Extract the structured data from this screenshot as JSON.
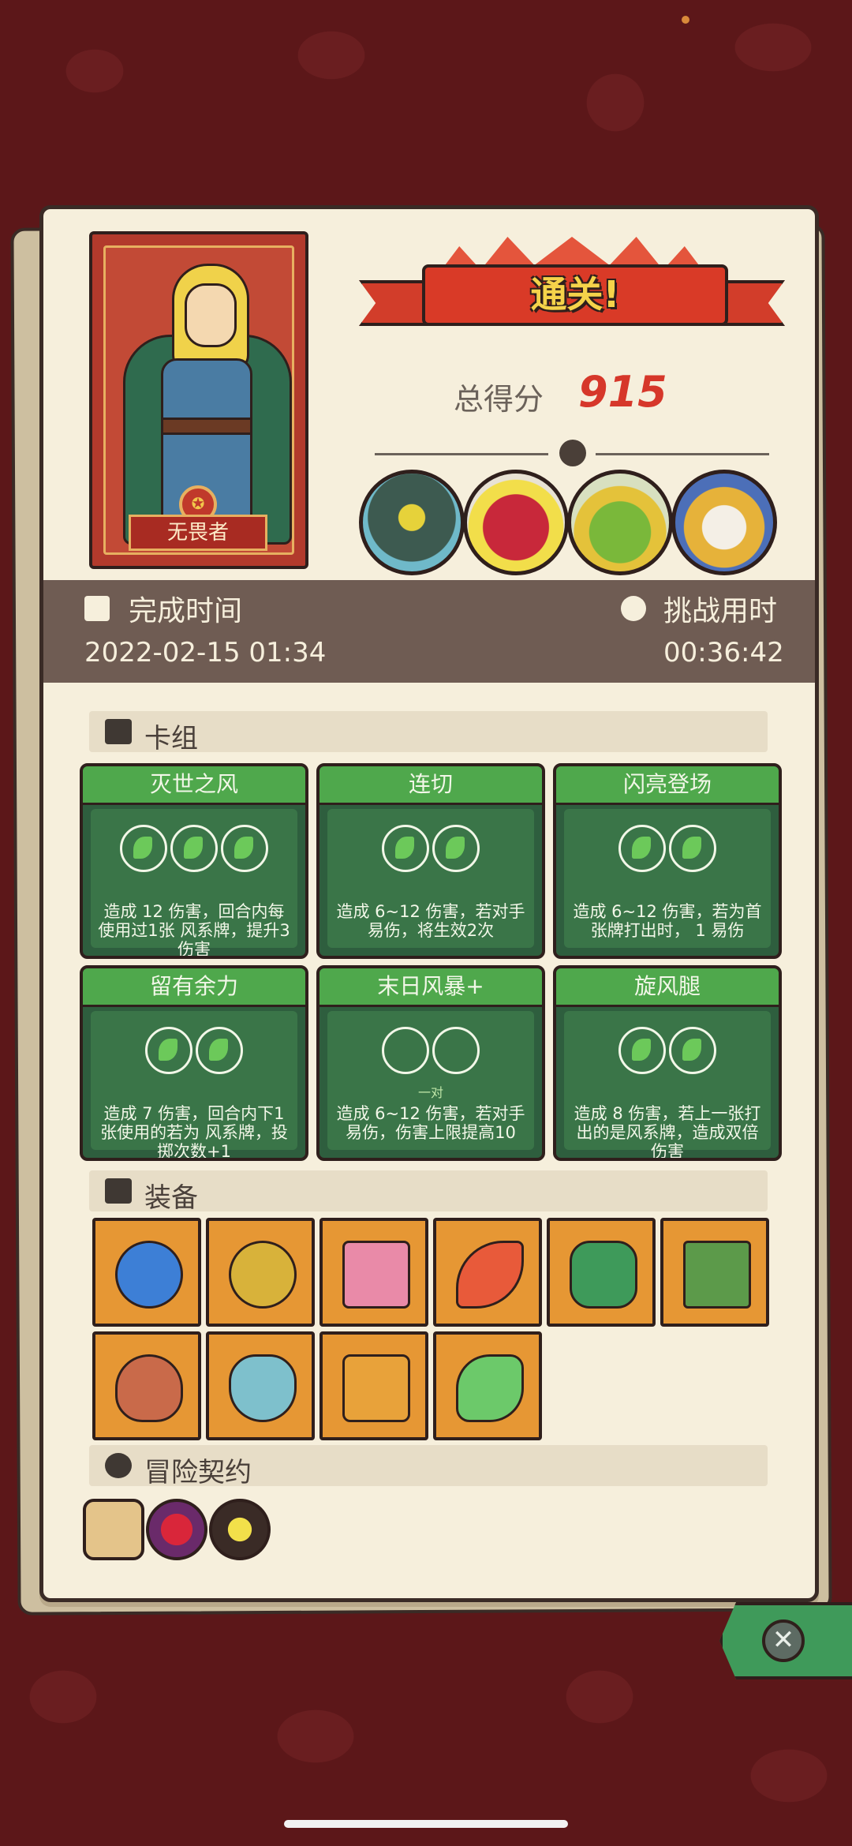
{
  "hero": {
    "name": "无畏者"
  },
  "banner": {
    "title": "通关!"
  },
  "score": {
    "label": "总得分",
    "value": "915"
  },
  "bosses": [
    "armored-boss-avatar",
    "red-demon-boss-avatar",
    "goblin-king-boss-avatar",
    "lion-boss-avatar"
  ],
  "time": {
    "finish_label": "完成时间",
    "finish_value": "2022-02-15 01:34",
    "challenge_label": "挑战用时",
    "challenge_value": "00:36:42"
  },
  "sections": {
    "deck": "卡组",
    "equipment": "装备",
    "contract": "冒险契约"
  },
  "cards": [
    {
      "name": "灭世之风",
      "orbs": 3,
      "desc": "造成 12 伤害，回合内每使用过1张 风系牌，提升3伤害"
    },
    {
      "name": "连切",
      "orbs": 2,
      "desc": "造成 6~12 伤害，若对手 易伤，将生效2次"
    },
    {
      "name": "闪亮登场",
      "orbs": 2,
      "desc": "造成 6~12 伤害，若为首张牌打出时， 1 易伤"
    },
    {
      "name": "留有余力",
      "orbs": 2,
      "desc": "造成 7 伤害，回合内下1张使用的若为 风系牌，投掷次数+1"
    },
    {
      "name": "末日风暴+",
      "orbs": 2,
      "orb_label": "一对",
      "desc": "造成 6~12 伤害，若对手 易伤，伤害上限提高10"
    },
    {
      "name": "旋风腿",
      "orbs": 2,
      "desc": "造成 8 伤害，若上一张打出的是风系牌，造成双倍伤害"
    }
  ],
  "equipment": [
    "blue-orb-item-icon",
    "gold-coin-item-icon",
    "heart-box-item-icon",
    "feather-item-icon",
    "green-gem-item-icon",
    "moss-stone-item-icon",
    "meat-item-icon",
    "vase-item-icon",
    "sweater-item-icon",
    "green-bird-item-icon"
  ],
  "contracts": [
    "scroll-contract-icon",
    "blood-drop-contract-icon",
    "flower-pot-contract-icon"
  ],
  "colors": {
    "accent_green": "#4fa84c",
    "score_red": "#d6372a",
    "paper": "#f6efdc"
  }
}
